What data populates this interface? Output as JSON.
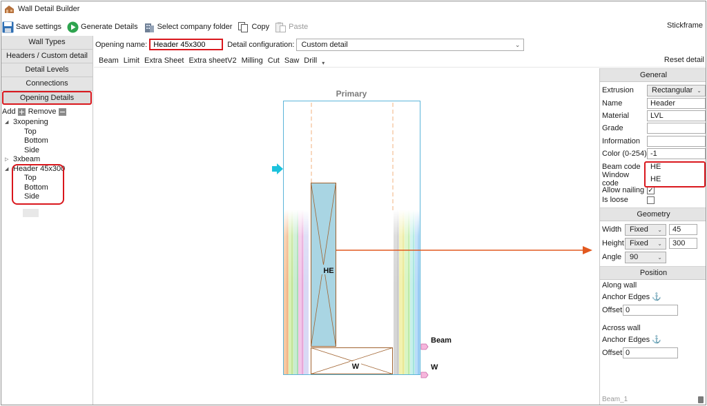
{
  "window": {
    "title": "Wall Detail Builder",
    "brand": "Stickframe"
  },
  "toolbar": {
    "save": "Save settings",
    "generate": "Generate Details",
    "select_folder": "Select company folder",
    "copy": "Copy",
    "paste": "Paste"
  },
  "leftnav": {
    "tabs": [
      "Wall Types",
      "Headers / Custom detail",
      "Detail Levels",
      "Connections",
      "Opening Details"
    ],
    "add_label": "Add",
    "remove_label": "Remove",
    "tree": [
      {
        "label": "3xopening",
        "expander": "◢",
        "children": [
          "Top",
          "Bottom",
          "Side"
        ]
      },
      {
        "label": "3xbeam",
        "expander": "▷",
        "children": []
      },
      {
        "label": "Header 45x300",
        "expander": "◢",
        "children": [
          "Top",
          "Bottom",
          "Side"
        ]
      }
    ]
  },
  "opening": {
    "name_label": "Opening name:",
    "name_value": "Header 45x300",
    "config_label": "Detail configuration:",
    "config_value": "Custom detail"
  },
  "tools": {
    "items": [
      "Beam",
      "Limit",
      "Extra Sheet",
      "Extra sheetV2",
      "Milling",
      "Cut",
      "Saw",
      "Drill"
    ],
    "reset": "Reset detail"
  },
  "canvas": {
    "primary_label": "Primary",
    "header_label": "HE",
    "window_label": "W",
    "marker_beam": "Beam",
    "marker_w": "W",
    "colors": {
      "frame": "#5ab4d9",
      "header_fill": "#a9d5e3",
      "wood": "#a0622e",
      "arrow": "#e2591f",
      "cyan": "#1cc2dc"
    }
  },
  "props": {
    "general_title": "General",
    "extrusion_label": "Extrusion",
    "extrusion_value": "Rectangular",
    "name_label": "Name",
    "name_value": "Header",
    "material_label": "Material",
    "material_value": "LVL",
    "grade_label": "Grade",
    "grade_value": "",
    "info_label": "Information",
    "info_value": "",
    "color_label": "Color (0-254)",
    "color_value": "-1",
    "beamcode_label": "Beam code",
    "beamcode_value": "HE",
    "windowcode_label": "Window code",
    "windowcode_value": "HE",
    "allow_nailing_label": "Allow nailing",
    "allow_nailing": true,
    "is_loose_label": "Is loose",
    "is_loose": false,
    "geometry_title": "Geometry",
    "width_label": "Width",
    "width_mode": "Fixed",
    "width_value": "45",
    "height_label": "Height",
    "height_mode": "Fixed",
    "height_value": "300",
    "angle_label": "Angle",
    "angle_value": "90",
    "position_title": "Position",
    "along_label": "Along wall",
    "along_anchor": "Anchor Edges",
    "along_offset_label": "Offset",
    "along_offset": "0",
    "across_label": "Across wall",
    "across_anchor": "Anchor Edges",
    "across_offset_label": "Offset",
    "across_offset": "0",
    "footer": "Beam_1"
  }
}
